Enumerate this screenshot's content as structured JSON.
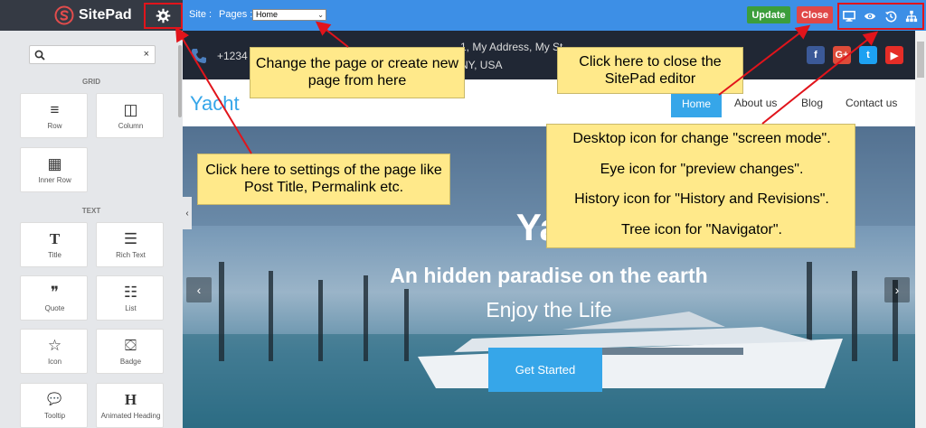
{
  "app": {
    "name": "SitePad"
  },
  "toolbar": {
    "site_label": "Site :",
    "pages_label": "Pages :",
    "page_select_value": "Home",
    "update_label": "Update",
    "close_label": "Close",
    "icons": [
      "desktop-icon",
      "eye-icon",
      "history-icon",
      "tree-icon"
    ]
  },
  "sidebar": {
    "search_clear": "×",
    "sections": [
      {
        "title": "GRID",
        "items": [
          {
            "label": "Row",
            "icon": "≡"
          },
          {
            "label": "Column",
            "icon": "◫"
          },
          {
            "label": "Inner Row",
            "icon": "▦"
          }
        ]
      },
      {
        "title": "TEXT",
        "items": [
          {
            "label": "Title",
            "icon": "T"
          },
          {
            "label": "Rich Text",
            "icon": "☰"
          },
          {
            "label": "Quote",
            "icon": "❞"
          },
          {
            "label": "List",
            "icon": "☷"
          },
          {
            "label": "Icon",
            "icon": "☆"
          },
          {
            "label": "Badge",
            "icon": "⛋"
          },
          {
            "label": "Tooltip",
            "icon": "💬"
          },
          {
            "label": "Animated Heading",
            "icon": "H"
          }
        ]
      }
    ],
    "collapse_arrow": "‹"
  },
  "site": {
    "phone": "+1234",
    "address_line1": "1, My Address, My St",
    "address_line2": "NY, USA",
    "social": [
      {
        "name": "facebook-icon",
        "glyph": "f",
        "color": "#3b5998"
      },
      {
        "name": "google-plus-icon",
        "glyph": "G+",
        "color": "#dd4b39"
      },
      {
        "name": "twitter-icon",
        "glyph": "t",
        "color": "#1da1f2"
      },
      {
        "name": "youtube-icon",
        "glyph": "▶",
        "color": "#e52d27"
      }
    ],
    "logo": "Yacht",
    "nav": [
      "Home",
      "About us",
      "Blog",
      "Contact us"
    ],
    "hero_title": "Yac",
    "hero_subtitle": "An hidden paradise on the earth",
    "hero_tagline": "Enjoy the Life",
    "hero_button": "Get Started",
    "prev_arrow": "‹",
    "next_arrow": "›"
  },
  "callouts": {
    "pages": "Change the page or create new page from here",
    "close": "Click here to close the SitePad editor",
    "settings": "Click here to settings of the page like Post Title, Permalink etc.",
    "icons_line1": "Desktop icon for change \"screen mode\".",
    "icons_line2": "Eye icon for \"preview changes\".",
    "icons_line3": "History icon for \"History and Revisions\".",
    "icons_line4": "Tree icon for \"Navigator\"."
  },
  "colors": {
    "topbar": "#3d8fe6",
    "brand": "#353a44",
    "update": "#3c9e3c",
    "close": "#e04747",
    "accent": "#36a6e9",
    "callout": "#ffe98a",
    "arrow": "#e1141b"
  }
}
